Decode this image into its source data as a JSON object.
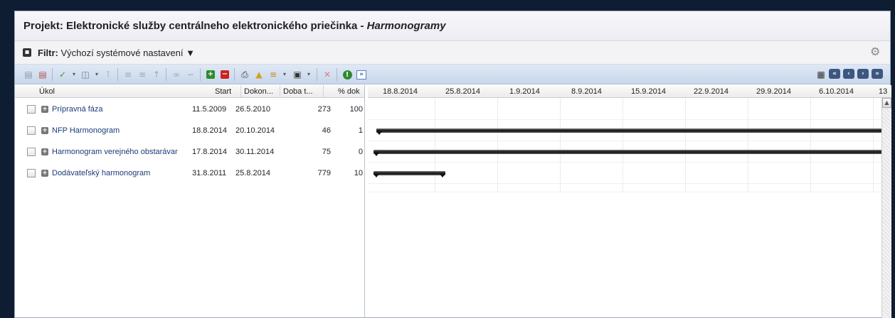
{
  "title": {
    "prefix": "Projekt: Elektronické služby centrálneho elektronického priečinka - ",
    "module": "Harmonogramy"
  },
  "filter": {
    "label": "Filtr:",
    "value": "Výchozí systémové nastavení",
    "dropdown_glyph": "▼",
    "expand_glyph": "▪",
    "settings_glyph": "⚙"
  },
  "toolbar": {
    "icons": [
      "save-icon",
      "save-as-icon",
      "check-icon",
      "import-icon",
      "tree-icon",
      "indent-icon",
      "outdent-icon",
      "up-icon",
      "link-icon",
      "unlink-icon",
      "add-icon",
      "remove-icon",
      "print-icon",
      "lock-icon",
      "filter-icon",
      "camera-icon",
      "close-icon",
      "warning-icon",
      "forward-icon"
    ],
    "nav": [
      "«",
      "‹",
      "›",
      "»"
    ],
    "calendar_glyph": "▦"
  },
  "grid": {
    "columns": [
      "Úkol",
      "Start",
      "Dokon...",
      "Doba t...",
      "% dok"
    ],
    "rows": [
      {
        "name": "Prípravná fáza",
        "start": "11.5.2009",
        "end": "26.5.2010",
        "duration": "273",
        "percent": "100"
      },
      {
        "name": "NFP Harmonogram",
        "start": "18.8.2014",
        "end": "20.10.2014",
        "duration": "46",
        "percent": "1"
      },
      {
        "name": "Harmonogram verejného obstarávar",
        "start": "17.8.2014",
        "end": "30.11.2014",
        "duration": "75",
        "percent": "0"
      },
      {
        "name": "Dodávateľský harmonogram",
        "start": "31.8.2011",
        "end": "25.8.2014",
        "duration": "779",
        "percent": "10"
      }
    ]
  },
  "gantt": {
    "weeks": [
      "18.8.2014",
      "25.8.2014",
      "1.9.2014",
      "8.9.2014",
      "15.9.2014",
      "22.9.2014",
      "29.9.2014",
      "6.10.2014",
      "13"
    ],
    "bars": [
      {
        "row": 1,
        "start_week": 0.05,
        "end_week": 8.2
      },
      {
        "row": 2,
        "start_week": 0,
        "end_week": 8.2
      },
      {
        "row": 3,
        "start_week": 0,
        "end_week": 1.15
      }
    ]
  },
  "plus_glyph": "+"
}
